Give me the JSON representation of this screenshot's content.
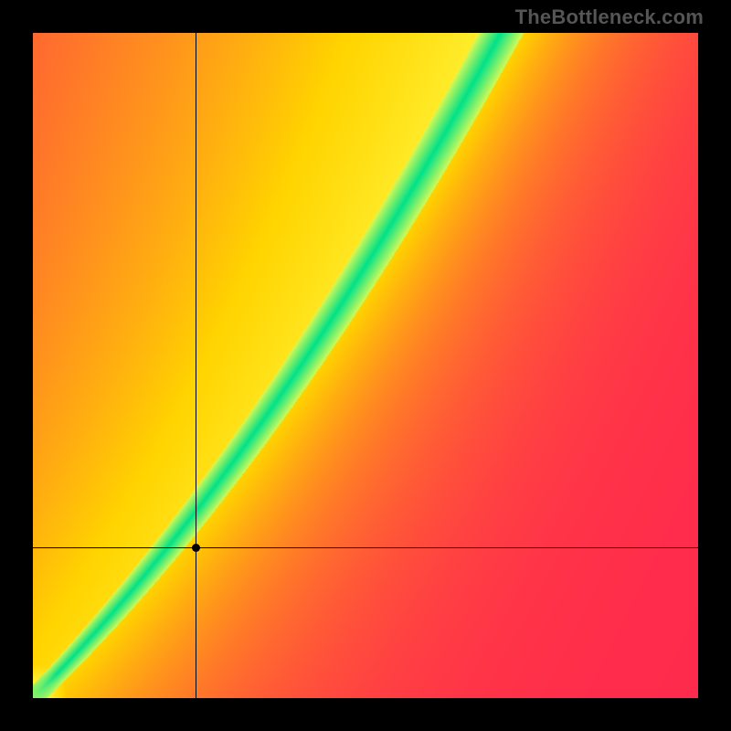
{
  "watermark": "TheBottleneck.com",
  "chart_data": {
    "type": "heatmap",
    "title": "",
    "xlabel": "",
    "ylabel": "",
    "xlim": [
      0,
      1
    ],
    "ylim": [
      0,
      1
    ],
    "grid": false,
    "legend": false,
    "crosshair": {
      "x": 0.245,
      "y": 0.225
    },
    "marker": {
      "x": 0.245,
      "y": 0.225
    },
    "optimal_curve": {
      "description": "Green ridge y ≈ x + 0.6·x² from (0,0) toward upper-right; distance from ridge maps to red→yellow→green gradient",
      "coeff_linear": 1.0,
      "coeff_quad": 0.6
    },
    "colorscale": [
      {
        "stop": 0.0,
        "color": "#ff2a4d"
      },
      {
        "stop": 0.5,
        "color": "#ffd400"
      },
      {
        "stop": 0.82,
        "color": "#ffff4d"
      },
      {
        "stop": 1.0,
        "color": "#00e28a"
      }
    ]
  }
}
